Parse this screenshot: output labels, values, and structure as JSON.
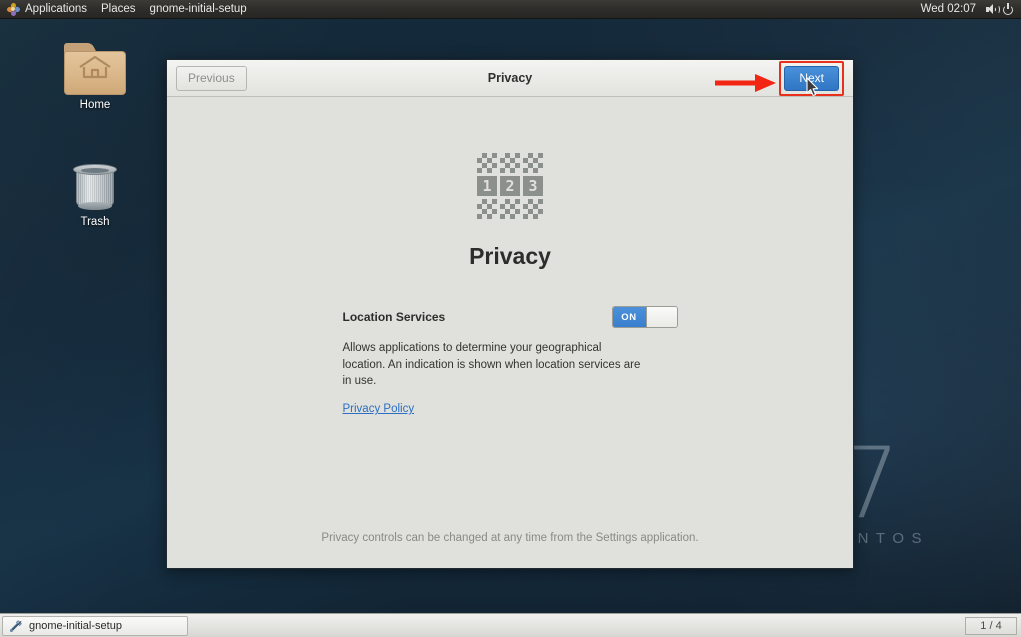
{
  "top_panel": {
    "menus": [
      {
        "label": "Applications",
        "icon": "gnome-foot-icon"
      },
      {
        "label": "Places"
      },
      {
        "label": "gnome-initial-setup"
      }
    ],
    "clock": "Wed 02:07",
    "icons": [
      "volume-icon",
      "power-icon"
    ]
  },
  "desktop": {
    "icons": [
      {
        "name": "home",
        "label": "Home",
        "icon": "home-folder-icon"
      },
      {
        "name": "trash",
        "label": "Trash",
        "icon": "trash-can-icon"
      }
    ],
    "watermark": {
      "number": "7",
      "name": "ENTOS"
    }
  },
  "window": {
    "title": "Privacy",
    "previous_label": "Previous",
    "next_label": "Next",
    "annotation": {
      "arrow": "red-arrow-right",
      "highlight_color": "#e8301c"
    }
  },
  "main": {
    "icon": "privacy-pixel-icon",
    "icon_digits": [
      "1",
      "2",
      "3"
    ],
    "heading": "Privacy",
    "setting": {
      "label": "Location Services",
      "toggle_state": "ON",
      "description": "Allows applications to determine your geographical location. An indication is shown when location services are in use.",
      "link_label": "Privacy Policy"
    },
    "footer_note": "Privacy controls can be changed at any time from the Settings application."
  },
  "taskbar": {
    "task_label": "gnome-initial-setup",
    "task_icon": "tools-icon",
    "workspace": "1 / 4"
  },
  "colors": {
    "accent_blue": "#4a90d9",
    "annotation_red": "#e8301c",
    "window_bg": "#e0e0dc",
    "link": "#2a6fc4"
  }
}
